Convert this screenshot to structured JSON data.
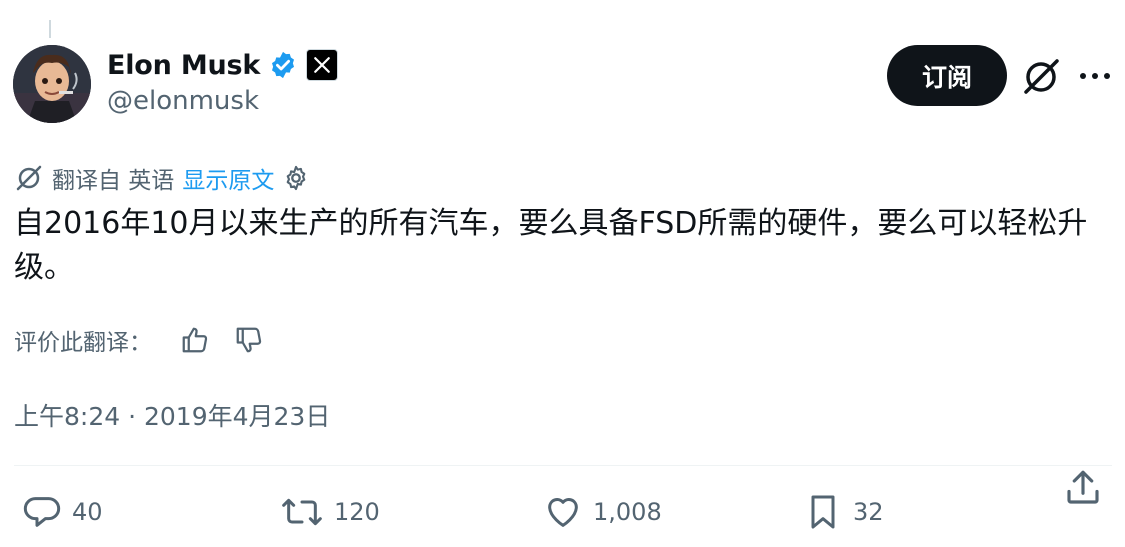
{
  "author": {
    "name": "Elon Musk",
    "handle": "@elonmusk",
    "verified_icon": "verified-badge-icon",
    "affiliation_icon": "x-logo-icon"
  },
  "header": {
    "subscribe_label": "订阅",
    "grok_icon": "grok-icon",
    "more_icon": "more-icon"
  },
  "translation": {
    "translated_from": "翻译自 英语",
    "show_original": "显示原文",
    "settings_icon": "gear-icon"
  },
  "tweet": {
    "text": "自2016年10月以来生产的所有汽车，要么具备FSD所需的硬件，要么可以轻松升级。"
  },
  "rating": {
    "label": "评价此翻译：",
    "up_icon": "thumbs-up-icon",
    "down_icon": "thumbs-down-icon"
  },
  "timestamp": "上午8:24 · 2019年4月23日",
  "actions": {
    "replies": "40",
    "reposts": "120",
    "likes": "1,008",
    "bookmarks": "32"
  },
  "colors": {
    "accent": "#1d9bf0",
    "text": "#0f1419",
    "secondary": "#536471",
    "button_bg": "#0f1419"
  }
}
